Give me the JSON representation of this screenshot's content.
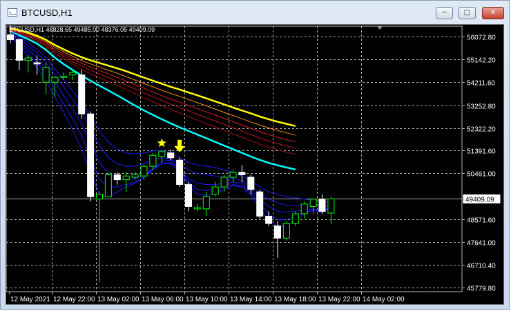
{
  "window": {
    "title": "BTCUSD,H1",
    "minimize_icon": "minimize-icon",
    "maximize_icon": "maximize-icon",
    "close_icon": "close-icon"
  },
  "chart_header": "BTCUSD,H1  48828.65 49485.00 48376.05 49409.09",
  "colors": {
    "background": "#000000",
    "grid": "#b4b4b4",
    "bull": "#00ff00",
    "bear": "#ffffff",
    "ema_fast": "#0000cd",
    "ema_cyan": "#00ffff",
    "ema_red": "#d01010",
    "ema_yellow": "#ffff00",
    "signal": "#ffff00"
  },
  "chart_data": {
    "type": "candlestick",
    "symbol": "BTCUSD",
    "timeframe": "H1",
    "y_ticks": [
      "56072.80",
      "55142.20",
      "54211.60",
      "53252.80",
      "52322.20",
      "51391.60",
      "50461.00",
      "49409.09",
      "48571.60",
      "47641.00",
      "46710.40",
      "45779.80"
    ],
    "ylim": [
      45600,
      56500
    ],
    "current_price": "49409.09",
    "x_ticks": [
      "12 May 2021",
      "12 May 22:00",
      "13 May 02:00",
      "13 May 06:00",
      "13 May 10:00",
      "13 May 14:00",
      "13 May 18:00",
      "13 May 22:00",
      "14 May 02:00"
    ],
    "candles": [
      {
        "o": 56150,
        "h": 56650,
        "l": 55800,
        "c": 55950
      },
      {
        "o": 55950,
        "h": 56000,
        "l": 54700,
        "c": 55100
      },
      {
        "o": 55100,
        "h": 55300,
        "l": 54600,
        "c": 55200
      },
      {
        "o": 55000,
        "h": 55300,
        "l": 54500,
        "c": 54950
      },
      {
        "o": 54200,
        "h": 55000,
        "l": 53700,
        "c": 54800
      },
      {
        "o": 54200,
        "h": 54400,
        "l": 53600,
        "c": 54400
      },
      {
        "o": 54400,
        "h": 54600,
        "l": 54300,
        "c": 54450
      },
      {
        "o": 54500,
        "h": 54700,
        "l": 54300,
        "c": 54600
      },
      {
        "o": 54500,
        "h": 54700,
        "l": 52700,
        "c": 52900
      },
      {
        "o": 52900,
        "h": 53000,
        "l": 49300,
        "c": 49500
      },
      {
        "o": 49400,
        "h": 49700,
        "l": 46000,
        "c": 49600
      },
      {
        "o": 49500,
        "h": 50500,
        "l": 49500,
        "c": 50400
      },
      {
        "o": 50400,
        "h": 50500,
        "l": 50000,
        "c": 50200
      },
      {
        "o": 50200,
        "h": 50500,
        "l": 49700,
        "c": 50350
      },
      {
        "o": 50300,
        "h": 50500,
        "l": 50200,
        "c": 50400
      },
      {
        "o": 50350,
        "h": 50800,
        "l": 50200,
        "c": 50750
      },
      {
        "o": 50750,
        "h": 51300,
        "l": 50600,
        "c": 51200
      },
      {
        "o": 51150,
        "h": 51400,
        "l": 50900,
        "c": 51350
      },
      {
        "o": 51300,
        "h": 51450,
        "l": 51000,
        "c": 51100
      },
      {
        "o": 51000,
        "h": 51100,
        "l": 49900,
        "c": 50000
      },
      {
        "o": 50000,
        "h": 50100,
        "l": 48900,
        "c": 49100
      },
      {
        "o": 49000,
        "h": 49200,
        "l": 48900,
        "c": 49050
      },
      {
        "o": 49000,
        "h": 49700,
        "l": 48700,
        "c": 49500
      },
      {
        "o": 49600,
        "h": 50100,
        "l": 49500,
        "c": 49900
      },
      {
        "o": 49900,
        "h": 50400,
        "l": 49700,
        "c": 50300
      },
      {
        "o": 50300,
        "h": 50600,
        "l": 50100,
        "c": 50500
      },
      {
        "o": 50500,
        "h": 50800,
        "l": 50100,
        "c": 50400
      },
      {
        "o": 50300,
        "h": 50400,
        "l": 49600,
        "c": 49800
      },
      {
        "o": 49700,
        "h": 49800,
        "l": 48600,
        "c": 48700
      },
      {
        "o": 48700,
        "h": 48900,
        "l": 48300,
        "c": 48400
      },
      {
        "o": 48300,
        "h": 48500,
        "l": 47000,
        "c": 47800
      },
      {
        "o": 47800,
        "h": 48500,
        "l": 47700,
        "c": 48400
      },
      {
        "o": 48400,
        "h": 48900,
        "l": 48300,
        "c": 48800
      },
      {
        "o": 48800,
        "h": 49300,
        "l": 48600,
        "c": 49200
      },
      {
        "o": 49100,
        "h": 49400,
        "l": 48800,
        "c": 49400
      },
      {
        "o": 49400,
        "h": 49600,
        "l": 48800,
        "c": 48900
      },
      {
        "o": 48829,
        "h": 49485,
        "l": 48376,
        "c": 49409
      }
    ],
    "ema_bands": [
      {
        "color": "#ffff00",
        "points": [
          56420,
          56340,
          56240,
          56110,
          55940,
          55730,
          55550,
          55380,
          55230,
          55100,
          54990,
          54880,
          54770,
          54650,
          54520,
          54390,
          54260,
          54140,
          54010,
          53900,
          53780,
          53660,
          53540,
          53410,
          53290,
          53160,
          53040,
          52920,
          52790,
          52680,
          52580,
          52490,
          52400
        ]
      },
      {
        "color": "#ff9000",
        "points": [
          56380,
          56300,
          56190,
          56050,
          55870,
          55640,
          55450,
          55260,
          55090,
          54950,
          54820,
          54690,
          54570,
          54430,
          54290,
          54150,
          54010,
          53870,
          53740,
          53620,
          53490,
          53360,
          53230,
          53100,
          52960,
          52830,
          52700,
          52570,
          52440,
          52320,
          52220,
          52120,
          52020
        ]
      },
      {
        "color": "#e02020",
        "points": [
          56350,
          56260,
          56140,
          55990,
          55800,
          55560,
          55360,
          55160,
          54980,
          54820,
          54680,
          54540,
          54400,
          54250,
          54100,
          53950,
          53800,
          53650,
          53510,
          53380,
          53250,
          53110,
          52980,
          52850,
          52710,
          52580,
          52440,
          52310,
          52170,
          52050,
          51940,
          51840,
          51750
        ]
      },
      {
        "color": "#c01818",
        "points": [
          56320,
          56220,
          56090,
          55930,
          55730,
          55480,
          55260,
          55050,
          54860,
          54690,
          54540,
          54390,
          54240,
          54080,
          53920,
          53760,
          53600,
          53450,
          53300,
          53160,
          53020,
          52880,
          52740,
          52610,
          52470,
          52330,
          52190,
          52050,
          51910,
          51790,
          51680,
          51580,
          51490
        ]
      },
      {
        "color": "#a01414",
        "points": [
          56290,
          56180,
          56040,
          55870,
          55660,
          55390,
          55160,
          54940,
          54730,
          54550,
          54390,
          54230,
          54070,
          53900,
          53730,
          53560,
          53400,
          53240,
          53090,
          52940,
          52790,
          52640,
          52500,
          52360,
          52220,
          52080,
          51940,
          51800,
          51660,
          51540,
          51430,
          51330,
          51240
        ]
      },
      {
        "color": "#00ffff",
        "points": [
          56260,
          56130,
          55970,
          55780,
          55530,
          55210,
          54940,
          54700,
          54470,
          54260,
          54060,
          53860,
          53660,
          53450,
          53240,
          53040,
          52860,
          52680,
          52510,
          52350,
          52200,
          52050,
          51900,
          51750,
          51600,
          51450,
          51300,
          51150,
          51010,
          50890,
          50790,
          50700,
          50620
        ]
      }
    ],
    "ema_fast": [
      {
        "color": "#1a1aff",
        "points": [
          56250,
          56080,
          55820,
          55550,
          55200,
          54750,
          54300,
          53850,
          53350,
          52800,
          52200,
          51750,
          51450,
          51300,
          51250,
          51300,
          51380,
          51400,
          51300,
          51100,
          50900,
          50800,
          50750,
          50700,
          50600,
          50500,
          50350,
          50150,
          49900,
          49700,
          49600,
          49500,
          49450,
          49400,
          49350,
          49300,
          49300
        ]
      },
      {
        "color": "#1a1aff",
        "points": [
          56200,
          56000,
          55700,
          55400,
          55000,
          54500,
          54000,
          53500,
          52950,
          52300,
          51600,
          51100,
          50850,
          50750,
          50750,
          50850,
          51000,
          51100,
          51050,
          50850,
          50600,
          50450,
          50400,
          50350,
          50300,
          50250,
          50150,
          49950,
          49650,
          49400,
          49250,
          49150,
          49150,
          49150,
          49150,
          49100,
          49150
        ]
      },
      {
        "color": "#1a1aff",
        "points": [
          56150,
          55900,
          55550,
          55200,
          54750,
          54200,
          53650,
          53100,
          52500,
          51750,
          50900,
          50450,
          50250,
          50200,
          50250,
          50400,
          50650,
          50850,
          50850,
          50600,
          50250,
          50050,
          50000,
          50000,
          50050,
          50100,
          50050,
          49800,
          49400,
          49100,
          48900,
          48850,
          48900,
          48950,
          49000,
          48950,
          49050
        ]
      },
      {
        "color": "#1a1aff",
        "points": [
          56100,
          55800,
          55400,
          55000,
          54500,
          53900,
          53300,
          52700,
          52000,
          51100,
          50200,
          49900,
          49900,
          50000,
          50100,
          50300,
          50600,
          50850,
          50900,
          50600,
          50100,
          49800,
          49750,
          49800,
          49900,
          50000,
          49950,
          49650,
          49200,
          48800,
          48550,
          48550,
          48700,
          48850,
          48950,
          48900,
          49050
        ]
      },
      {
        "color": "#1a1aff",
        "points": [
          56050,
          55700,
          55250,
          54800,
          54250,
          53600,
          52950,
          52250,
          51450,
          50500,
          49600,
          49500,
          49700,
          49900,
          50050,
          50300,
          50650,
          50950,
          51000,
          50650,
          50000,
          49600,
          49550,
          49650,
          49800,
          49950,
          49900,
          49550,
          49000,
          48550,
          48250,
          48300,
          48550,
          48800,
          48950,
          48850,
          49050
        ]
      }
    ],
    "signals": [
      {
        "type": "star",
        "index": 17,
        "y": 51700,
        "color": "#ffff00"
      },
      {
        "type": "arrow-down",
        "index": 19,
        "y": 51550,
        "color": "#ffff00"
      }
    ]
  }
}
